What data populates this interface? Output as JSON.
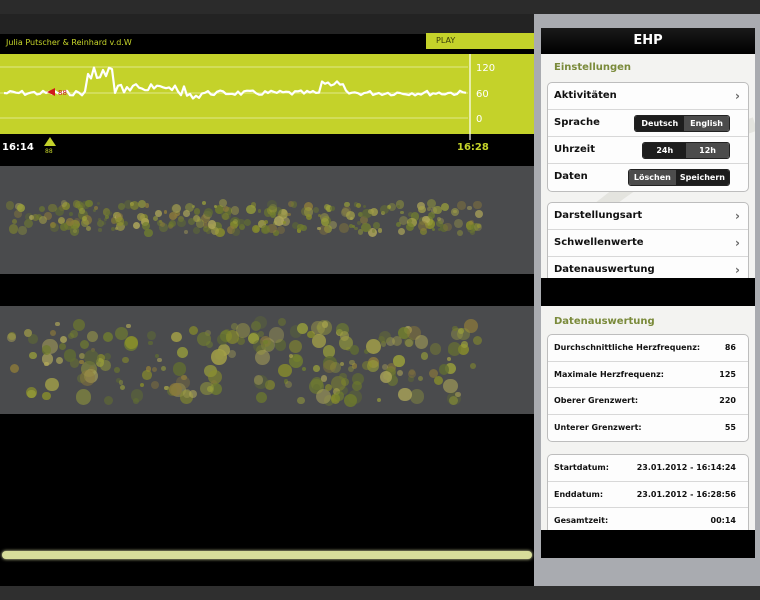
{
  "header": {
    "authors": "Julia Putscher & Reinhard v.d.W",
    "play_label": "PLAY"
  },
  "heart_rate": {
    "current_value": "88",
    "slider_value": "88",
    "axis_ticks": [
      "120",
      "60",
      "0"
    ],
    "start_time": "16:14",
    "end_time": "16:28",
    "colors": {
      "background": "#c4d22a",
      "line": "#ffffff",
      "marker": "#d01a1a"
    }
  },
  "sidebar": {
    "title": "EHP",
    "settings_title": "Einstellungen",
    "settings": {
      "activities": "Aktivitäten",
      "language_label": "Sprache",
      "language_options": [
        "Deutsch",
        "English"
      ],
      "time_label": "Uhrzeit",
      "time_options": [
        "24h",
        "12h"
      ],
      "data_label": "Daten",
      "data_options": [
        "Löschen",
        "Speichern"
      ]
    },
    "menu": [
      "Darstellungsart",
      "Schwellenwerte",
      "Datenauswertung"
    ],
    "analysis_title": "Datenauswertung",
    "stats": [
      {
        "label": "Durchschnittliche Herzfrequenz:",
        "value": "86"
      },
      {
        "label": "Maximale Herzfrequenz:",
        "value": "125"
      },
      {
        "label": "Oberer Grenzwert:",
        "value": "220"
      },
      {
        "label": "Unterer Grenzwert:",
        "value": "55"
      }
    ],
    "times": [
      {
        "label": "Startdatum:",
        "value": "23.01.2012 - 16:14:24"
      },
      {
        "label": "Enddatum:",
        "value": "23.01.2012 - 16:28:56"
      },
      {
        "label": "Gesamtzeit:",
        "value": "00:14"
      }
    ]
  }
}
